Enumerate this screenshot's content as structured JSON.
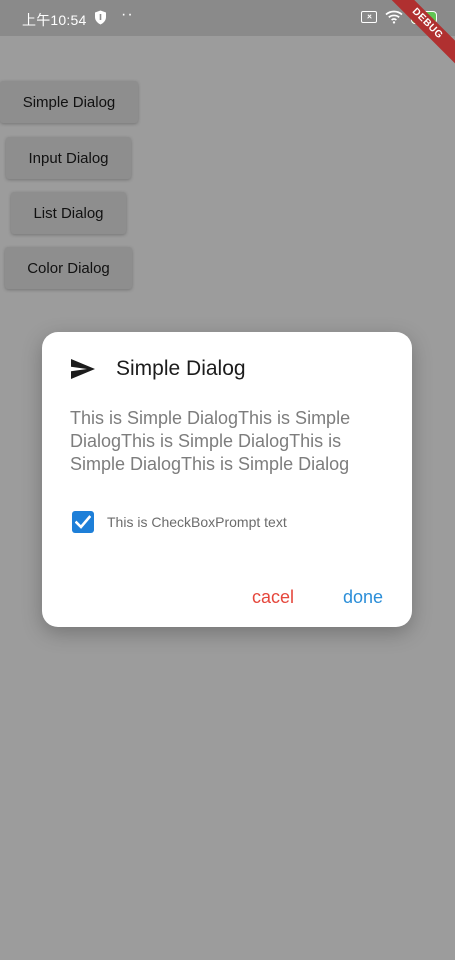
{
  "status_bar": {
    "time": "上午10:54",
    "dots": "··"
  },
  "debug_banner": {
    "label": "DEBUG"
  },
  "background_buttons": {
    "simple": "Simple Dialog",
    "input": "Input Dialog",
    "list": "List Dialog",
    "color": "Color Dialog"
  },
  "dialog": {
    "title": "Simple Dialog",
    "message": "This is Simple DialogThis is Simple DialogThis is Simple DialogThis is Simple DialogThis is Simple Dialog",
    "checkbox": {
      "checked": true,
      "label": "This is CheckBoxPrompt text"
    },
    "cancel_label": "cacel",
    "done_label": "done"
  },
  "icons": {
    "title_icon": "send-icon",
    "status": [
      "shield-icon",
      "sim-off-icon",
      "wifi-icon",
      "battery-icon"
    ]
  },
  "colors": {
    "cancel": "#e5473c",
    "done": "#2b8ed8",
    "checkbox": "#1e7fd8",
    "debug_banner": "#b03030"
  }
}
